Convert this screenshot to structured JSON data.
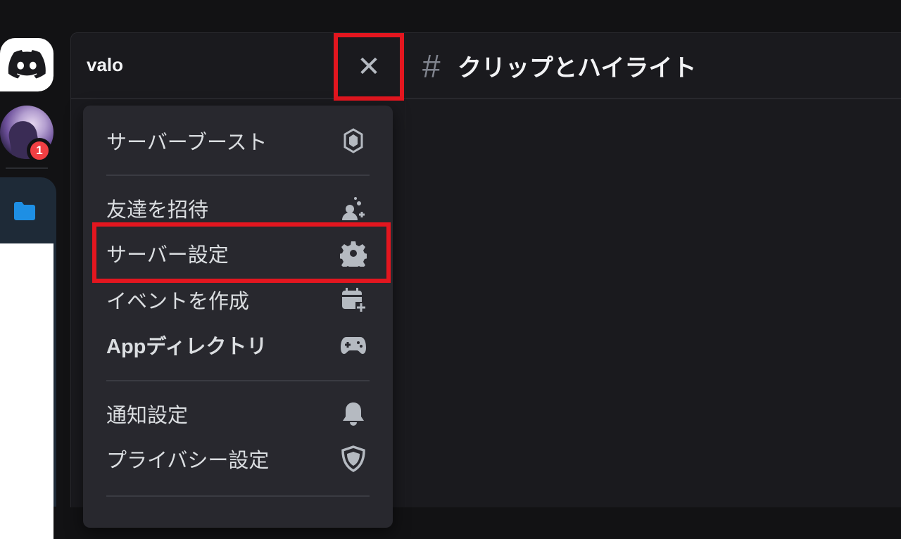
{
  "server": {
    "name": "valo",
    "close_symbol": "✕"
  },
  "rail": {
    "notification_count": "1"
  },
  "channel": {
    "hash": "#",
    "name": "クリップとハイライト"
  },
  "menu": {
    "items": [
      {
        "label": "サーバーブースト",
        "icon": "boost-gem-icon"
      },
      {
        "label": "友達を招待",
        "icon": "invite-person-icon"
      },
      {
        "label": "サーバー設定",
        "icon": "gear-icon"
      },
      {
        "label": "イベントを作成",
        "icon": "calendar-plus-icon"
      },
      {
        "label": "Appディレクトリ",
        "icon": "gamepad-icon"
      },
      {
        "label": "通知設定",
        "icon": "bell-icon"
      },
      {
        "label": "プライバシー設定",
        "icon": "shield-icon"
      }
    ]
  },
  "colors": {
    "highlight": "#e3161f",
    "badge": "#f23f43",
    "background": "#1a1a1e",
    "menu": "#28282e"
  }
}
